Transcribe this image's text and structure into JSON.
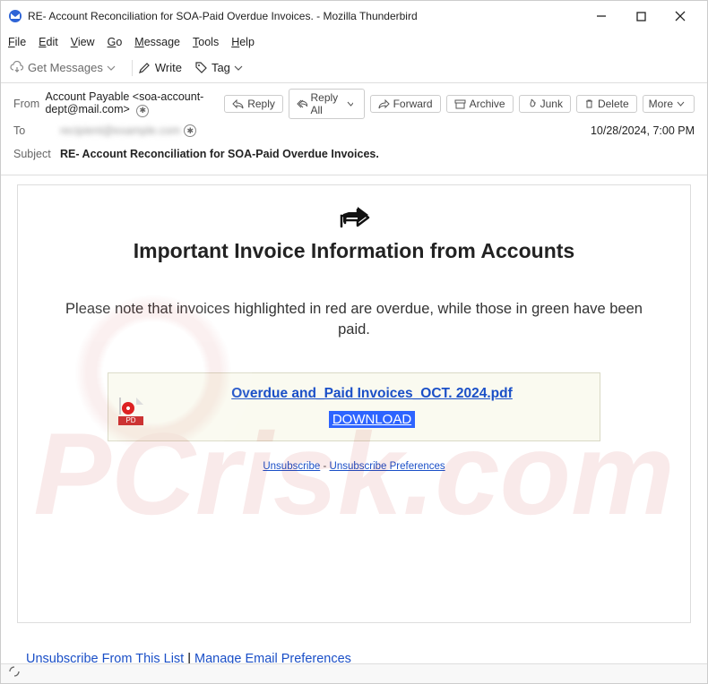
{
  "window": {
    "title": "RE- Account Reconciliation for SOA-Paid Overdue Invoices. - Mozilla Thunderbird"
  },
  "menubar": [
    "File",
    "Edit",
    "View",
    "Go",
    "Message",
    "Tools",
    "Help"
  ],
  "toolbar": {
    "get_messages": "Get Messages",
    "write": "Write",
    "tag": "Tag"
  },
  "headers": {
    "from_label": "From",
    "from_name": "Account Payable",
    "from_email": "<soa-account-dept@mail.com>",
    "to_label": "To",
    "to_value": "recipient@example.com",
    "subject_label": "Subject",
    "subject_value": "RE- Account Reconciliation for SOA-Paid Overdue Invoices.",
    "date": "10/28/2024, 7:00 PM",
    "reply": "Reply",
    "reply_all": "Reply All",
    "forward": "Forward",
    "archive": "Archive",
    "junk": "Junk",
    "delete": "Delete",
    "more": "More"
  },
  "email_body": {
    "title": "Important Invoice Information from Accounts",
    "paragraph": "Please note that invoices highlighted in red are overdue, while those in green have been paid.",
    "attachment_name": "Overdue and_Paid Invoices_OCT. 2024.pdf",
    "download": "DOWNLOAD",
    "pdf_badge": "PD",
    "unsubscribe": "Unsubscribe",
    "unsub_prefs": "Unsubscribe Preferences",
    "sep": " - "
  },
  "footer": {
    "unsub_list": "Unsubscribe From This List",
    "manage_prefs": "Manage Email Preferences",
    "sep": " | "
  },
  "watermark": "PCrisk.com"
}
